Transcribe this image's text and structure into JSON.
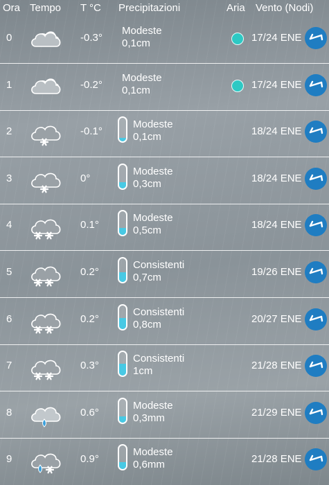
{
  "header": {
    "hour": "Ora",
    "weather": "Tempo",
    "temp": "T °C",
    "precip": "Precipitazioni",
    "air": "Aria",
    "wind": "Vento (Nodi)"
  },
  "rows": [
    {
      "hour": "0",
      "icon": "cloudy-icon",
      "temp": "-0.3°",
      "precip_label": "Modeste",
      "precip_amount": "0,1cm",
      "gauge": null,
      "air": true,
      "wind": "17/24 ENE",
      "wind_dir": "ENE"
    },
    {
      "hour": "1",
      "icon": "cloudy-icon",
      "temp": "-0.2°",
      "precip_label": "Modeste",
      "precip_amount": "0,1cm",
      "gauge": null,
      "air": true,
      "wind": "17/24 ENE",
      "wind_dir": "ENE"
    },
    {
      "hour": "2",
      "icon": "light-snow-icon",
      "temp": "-0.1°",
      "precip_label": "Modeste",
      "precip_amount": "0,1cm",
      "gauge": 0.15,
      "air": false,
      "wind": "18/24 ENE",
      "wind_dir": "ENE"
    },
    {
      "hour": "3",
      "icon": "light-snow-icon",
      "temp": "0°",
      "precip_label": "Modeste",
      "precip_amount": "0,3cm",
      "gauge": 0.25,
      "air": false,
      "wind": "18/24 ENE",
      "wind_dir": "ENE"
    },
    {
      "hour": "4",
      "icon": "snow-icon",
      "temp": "0.1°",
      "precip_label": "Modeste",
      "precip_amount": "0,5cm",
      "gauge": 0.3,
      "air": false,
      "wind": "18/24 ENE",
      "wind_dir": "ENE"
    },
    {
      "hour": "5",
      "icon": "snow-icon",
      "temp": "0.2°",
      "precip_label": "Consistenti",
      "precip_amount": "0,7cm",
      "gauge": 0.4,
      "air": false,
      "wind": "19/26 ENE",
      "wind_dir": "ENE"
    },
    {
      "hour": "6",
      "icon": "snow-icon",
      "temp": "0.2°",
      "precip_label": "Consistenti",
      "precip_amount": "0,8cm",
      "gauge": 0.45,
      "air": false,
      "wind": "20/27 ENE",
      "wind_dir": "ENE"
    },
    {
      "hour": "7",
      "icon": "snow-icon",
      "temp": "0.3°",
      "precip_label": "Consistenti",
      "precip_amount": "1cm",
      "gauge": 0.5,
      "air": false,
      "wind": "21/28 ENE",
      "wind_dir": "ENE"
    },
    {
      "hour": "8",
      "icon": "rain-icon",
      "temp": "0.6°",
      "precip_label": "Modeste",
      "precip_amount": "0,3mm",
      "gauge": 0.25,
      "air": false,
      "wind": "21/29 ENE",
      "wind_dir": "ENE"
    },
    {
      "hour": "9",
      "icon": "sleet-icon",
      "temp": "0.9°",
      "precip_label": "Modeste",
      "precip_amount": "0,6mm",
      "gauge": 0.3,
      "air": false,
      "wind": "21/28 ENE",
      "wind_dir": "ENE"
    }
  ],
  "colors": {
    "gauge_fill": "#48c9e4",
    "air_dot": "#2dc9c4",
    "wind_badge": "#1f7dc2"
  }
}
